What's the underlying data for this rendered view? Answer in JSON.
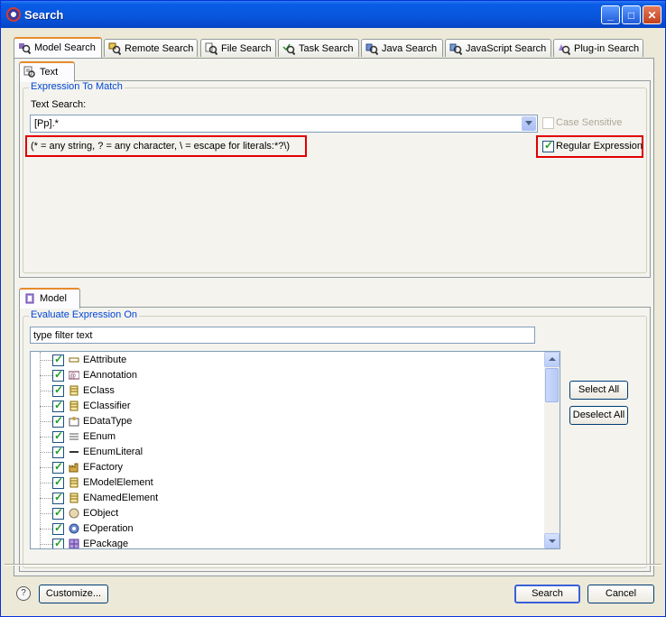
{
  "window": {
    "title": "Search",
    "min": "_",
    "max": "□",
    "close": "✕"
  },
  "search_tabs": [
    {
      "label": "Model Search",
      "icon": "model-search-icon"
    },
    {
      "label": "Remote Search",
      "icon": "remote-search-icon"
    },
    {
      "label": "File Search",
      "icon": "file-search-icon"
    },
    {
      "label": "Task Search",
      "icon": "task-search-icon"
    },
    {
      "label": "Java Search",
      "icon": "java-search-icon"
    },
    {
      "label": "JavaScript Search",
      "icon": "javascript-search-icon"
    },
    {
      "label": "Plug-in Search",
      "icon": "plugin-search-icon"
    }
  ],
  "inner_tab": {
    "label": "Text"
  },
  "expression": {
    "group_title": "Expression To Match",
    "text_search_label": "Text Search:",
    "value": "[Pp].*",
    "hint": "(* = any string, ? = any character, \\ = escape for literals:*?\\)",
    "case_sensitive": {
      "label": "Case Sensitive",
      "checked": false,
      "enabled": false
    },
    "regular_expression": {
      "label": "Regular Expression",
      "checked": true
    }
  },
  "model_tab": {
    "label": "Model"
  },
  "evaluate": {
    "group_title": "Evaluate Expression On",
    "filter_value": "type filter text",
    "items": [
      {
        "label": "EAttribute",
        "checked": true,
        "icon": "attribute-icon"
      },
      {
        "label": "EAnnotation",
        "checked": true,
        "icon": "annotation-icon"
      },
      {
        "label": "EClass",
        "checked": true,
        "icon": "class-icon"
      },
      {
        "label": "EClassifier",
        "checked": true,
        "icon": "classifier-icon"
      },
      {
        "label": "EDataType",
        "checked": true,
        "icon": "datatype-icon"
      },
      {
        "label": "EEnum",
        "checked": true,
        "icon": "enum-icon"
      },
      {
        "label": "EEnumLiteral",
        "checked": true,
        "icon": "enum-literal-icon"
      },
      {
        "label": "EFactory",
        "checked": true,
        "icon": "factory-icon"
      },
      {
        "label": "EModelElement",
        "checked": true,
        "icon": "model-element-icon"
      },
      {
        "label": "ENamedElement",
        "checked": true,
        "icon": "named-element-icon"
      },
      {
        "label": "EObject",
        "checked": true,
        "icon": "object-icon"
      },
      {
        "label": "EOperation",
        "checked": true,
        "icon": "operation-icon"
      },
      {
        "label": "EPackage",
        "checked": true,
        "icon": "package-icon"
      }
    ],
    "select_all": "Select All",
    "deselect_all": "Deselect All"
  },
  "footer": {
    "help": "?",
    "customize": "Customize...",
    "search": "Search",
    "cancel": "Cancel"
  }
}
